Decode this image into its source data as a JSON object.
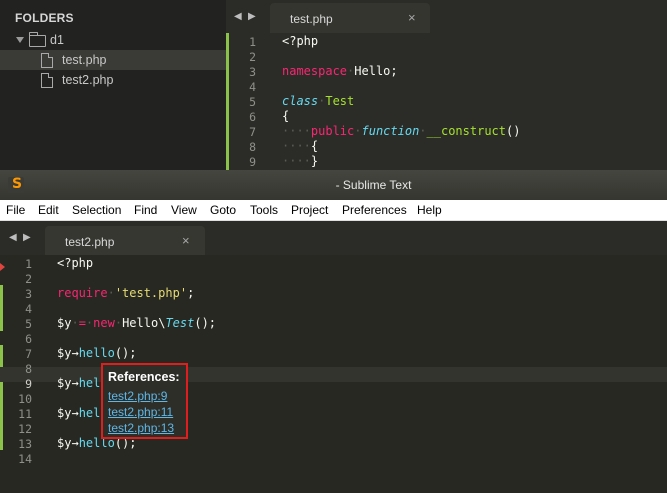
{
  "top_window": {
    "sidebar": {
      "title": "FOLDERS",
      "folder": "d1",
      "files": [
        "test.php",
        "test2.php"
      ]
    },
    "tab": {
      "label": "test.php",
      "close": "×"
    },
    "line_numbers": [
      "1",
      "2",
      "3",
      "4",
      "5",
      "6",
      "7",
      "8",
      "9"
    ]
  },
  "titlebar": {
    "title": "- Sublime Text",
    "icon": "S"
  },
  "menubar": {
    "items": [
      "File",
      "Edit",
      "Selection",
      "Find",
      "View",
      "Goto",
      "Tools",
      "Project",
      "Preferences",
      "Help"
    ]
  },
  "main": {
    "tab": {
      "label": "test2.php",
      "close": "×"
    },
    "line_numbers": [
      "1",
      "2",
      "3",
      "4",
      "5",
      "6",
      "7",
      "8",
      "9",
      "10",
      "11",
      "12",
      "13",
      "14"
    ]
  },
  "popup": {
    "title": "References:",
    "links": [
      "test2.php:9",
      "test2.php:11",
      "test2.php:13"
    ]
  },
  "colors": {
    "editor_bg": "#272822",
    "keyword": "#f92672",
    "storage": "#66d9ef",
    "entity": "#a6e22e",
    "string": "#e6db74",
    "gutter_modified": "#8bc34a",
    "popup_border": "#e01e1e",
    "link": "#5fb7e8"
  },
  "icons": [
    "folder-icon",
    "file-icon",
    "close-icon",
    "nav-left-icon",
    "nav-right-icon",
    "sublime-logo-icon"
  ]
}
